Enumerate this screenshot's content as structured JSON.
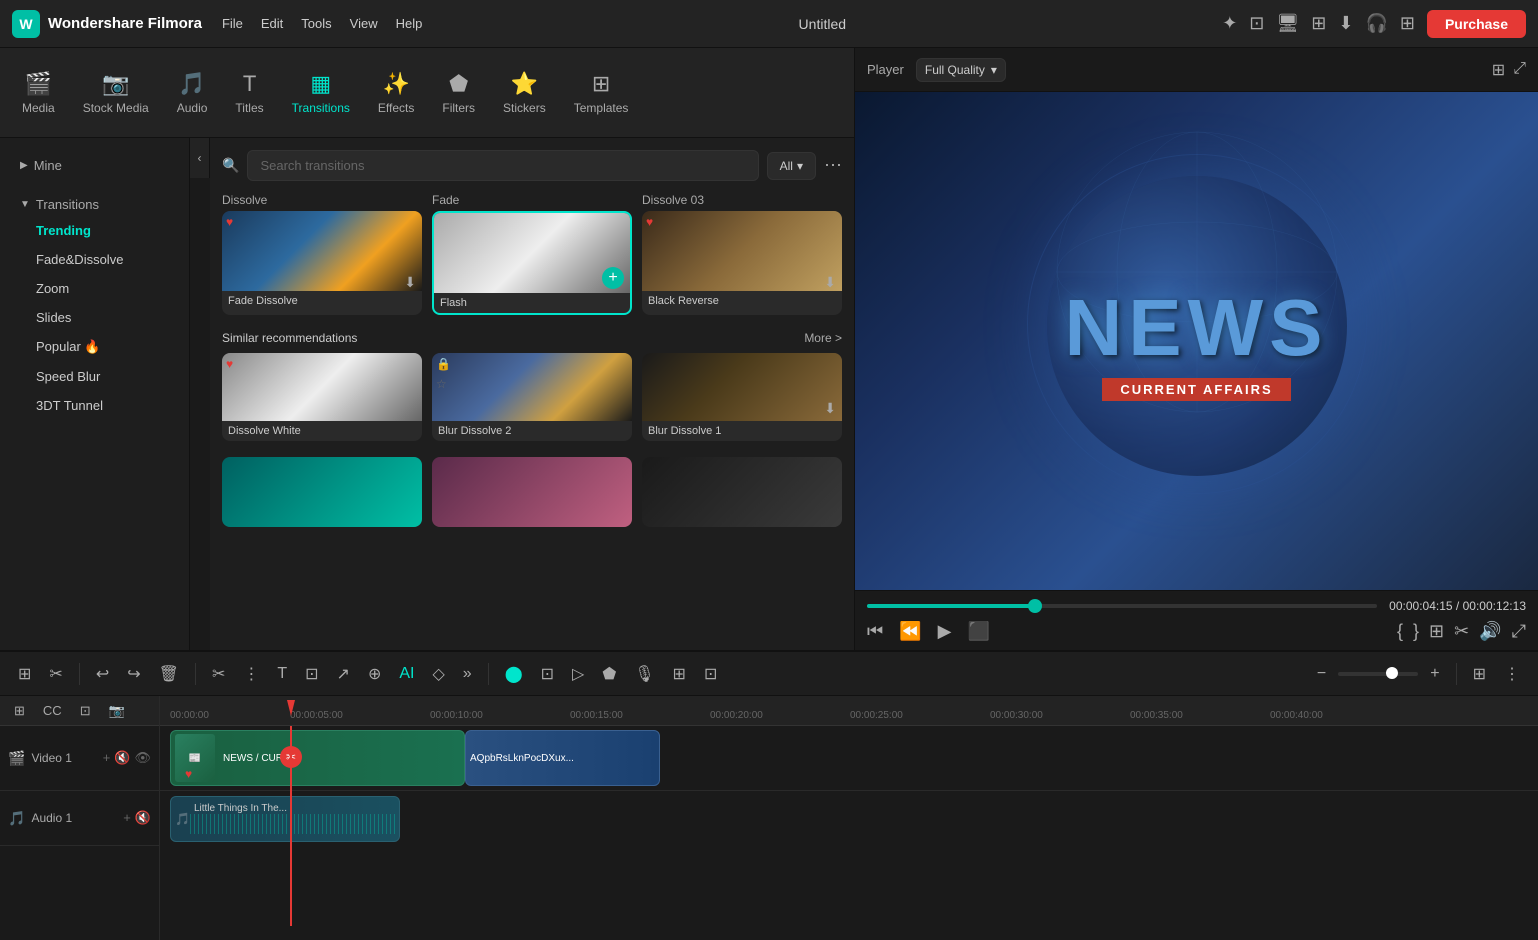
{
  "app": {
    "name": "Wondershare Filmora",
    "title": "Untitled",
    "purchase_label": "Purchase"
  },
  "topbar": {
    "nav": [
      "File",
      "Edit",
      "Tools",
      "View",
      "Help"
    ],
    "title": "Untitled"
  },
  "tabs": [
    {
      "id": "media",
      "label": "Media",
      "icon": "🎬"
    },
    {
      "id": "stock_media",
      "label": "Stock Media",
      "icon": "📷"
    },
    {
      "id": "audio",
      "label": "Audio",
      "icon": "🎵"
    },
    {
      "id": "titles",
      "label": "Titles",
      "icon": "T"
    },
    {
      "id": "transitions",
      "label": "Transitions",
      "icon": "▦",
      "active": true
    },
    {
      "id": "effects",
      "label": "Effects",
      "icon": "✨"
    },
    {
      "id": "filters",
      "label": "Filters",
      "icon": "⬟"
    },
    {
      "id": "stickers",
      "label": "Stickers",
      "icon": "⭐"
    },
    {
      "id": "templates",
      "label": "Templates",
      "icon": "⊞"
    }
  ],
  "sidebar": {
    "sections": [
      {
        "label": "Mine",
        "collapsed": true,
        "items": []
      },
      {
        "label": "Transitions",
        "collapsed": false,
        "items": [
          {
            "id": "trending",
            "label": "Trending",
            "active": true
          },
          {
            "id": "fade_dissolve",
            "label": "Fade&Dissolve"
          },
          {
            "id": "zoom",
            "label": "Zoom"
          },
          {
            "id": "slides",
            "label": "Slides"
          },
          {
            "id": "popular",
            "label": "Popular 🔥"
          },
          {
            "id": "speed_blur",
            "label": "Speed Blur"
          },
          {
            "id": "3d_tunnel",
            "label": "3DT Tunnel"
          }
        ]
      }
    ]
  },
  "search": {
    "placeholder": "Search transitions",
    "filter_label": "All"
  },
  "transitions": {
    "row1": [
      {
        "name": "Dissolve",
        "type": "dissolve",
        "favorited": true,
        "downloadable": true
      },
      {
        "name": "Fade",
        "type": "fade",
        "favorited": false,
        "downloadable": false,
        "selected": true
      },
      {
        "name": "Dissolve 03",
        "type": "dissolve03",
        "favorited": true,
        "downloadable": true
      }
    ],
    "row1_labels": [
      "Fade Dissolve",
      "Flash",
      "Black Reverse"
    ],
    "similar_section": "Similar recommendations",
    "more_link": "More >",
    "similar": [
      {
        "name": "Dissolve White",
        "type": "dissolve-white",
        "favorited": true
      },
      {
        "name": "Blur Dissolve 2",
        "type": "blur-dissolve2",
        "favorited": false
      },
      {
        "name": "Blur Dissolve 1",
        "type": "blur-dissolve1",
        "favorited": false
      }
    ]
  },
  "player": {
    "label": "Player",
    "quality": "Full Quality",
    "time_current": "00:00:04:15",
    "time_total": "00:00:12:13",
    "progress_pct": 33
  },
  "preview": {
    "news_text": "NEWS",
    "news_subtext": "CURRENT AFFAIRS"
  },
  "timeline": {
    "tracks": [
      {
        "id": "video1",
        "label": "Video 1",
        "type": "video",
        "clips": [
          {
            "label": "NEWS / CURR...",
            "type": "news"
          },
          {
            "label": "AQpbRsLknPocDXux...",
            "type": "stock"
          }
        ]
      },
      {
        "id": "audio1",
        "label": "Audio 1",
        "type": "audio",
        "clips": [
          {
            "label": "Little Things In The..."
          }
        ]
      }
    ],
    "ruler_marks": [
      "00:00:00",
      "00:00:05:00",
      "00:00:10:00",
      "00:00:15:00",
      "00:00:20:00",
      "00:00:25:00",
      "00:00:30:00",
      "00:00:35:00",
      "00:00:40:00"
    ]
  }
}
